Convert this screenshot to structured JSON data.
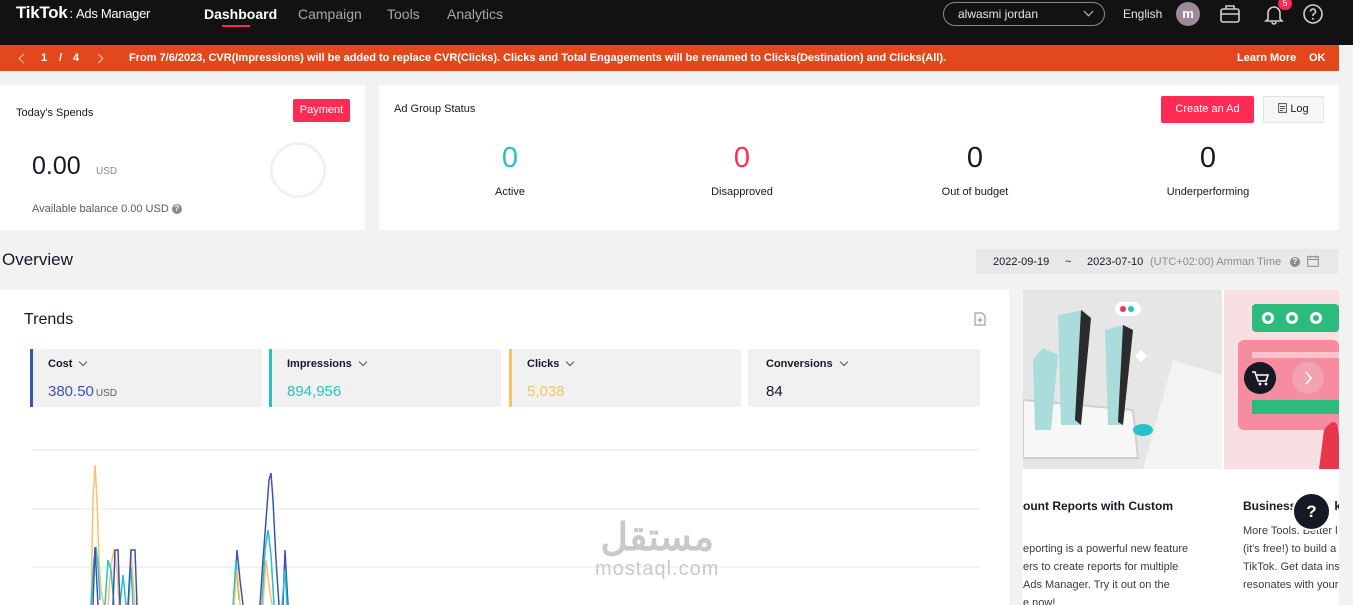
{
  "brand": {
    "logo": "TikTok",
    "product": "Ads Manager"
  },
  "nav": {
    "items": [
      {
        "label": "Dashboard",
        "active": true
      },
      {
        "label": "Campaign",
        "active": false
      },
      {
        "label": "Tools",
        "active": false
      },
      {
        "label": "Analytics",
        "active": false
      }
    ]
  },
  "header": {
    "account_name": "alwasmi jordan",
    "language": "English",
    "avatar_letter": "m",
    "notification_count": "5"
  },
  "banner": {
    "page_current": "1",
    "page_separator": "/",
    "page_total": "4",
    "message": "From 7/6/2023, CVR(Impressions) will be added to replace CVR(Clicks). Clicks and Total Engagements will be renamed to Clicks(Destination) and Clicks(All).",
    "learn_more": "Learn More",
    "ok": "OK",
    "color": "#e2481c"
  },
  "spends": {
    "title": "Today's Spends",
    "payment_label": "Payment",
    "amount": "0.00",
    "currency": "USD",
    "balance_text": "Available balance 0.00 USD"
  },
  "ad_group_status": {
    "title": "Ad Group Status",
    "create_label": "Create an Ad",
    "log_label": "Log",
    "stats": [
      {
        "value": "0",
        "label": "Active",
        "color": "#25c2c7"
      },
      {
        "value": "0",
        "label": "Disapproved",
        "color": "#fe2c55"
      },
      {
        "value": "0",
        "label": "Out of budget",
        "color": "#161823"
      },
      {
        "value": "0",
        "label": "Underperforming",
        "color": "#161823"
      }
    ]
  },
  "overview": {
    "title": "Overview",
    "date_start": "2022-09-19",
    "date_sep": "~",
    "date_end": "2023-07-10",
    "timezone": "(UTC+02:00) Amman Time"
  },
  "trends": {
    "title": "Trends",
    "metrics": [
      {
        "label": "Cost",
        "value": "380.50",
        "unit": "USD",
        "color": "#3f51b5"
      },
      {
        "label": "Impressions",
        "value": "894,956",
        "unit": "",
        "color": "#25c2c7"
      },
      {
        "label": "Clicks",
        "value": "5,038",
        "unit": "",
        "color": "#f7c26e"
      },
      {
        "label": "Conversions",
        "value": "84",
        "unit": "",
        "color": "#d8d8d8"
      }
    ]
  },
  "promo": {
    "card1_title": "ount Reports with Custom",
    "card1_lines": [
      "eporting is a powerful new feature",
      "ers to create reports for multiple",
      "Ads Manager. Try it out on the",
      "e now!"
    ],
    "card2_title": "Business",
    "card2_title_cut": "kT",
    "card2_lines": [
      "More Tools. Better l",
      "(it's free!) to build a",
      "TikTok. Get data ins",
      "resonates with your"
    ]
  },
  "watermark": {
    "arabic": "مستقل",
    "latin": "mostaql.com"
  },
  "colors": {
    "accent": "#fe2c55",
    "nav_bg": "#121212",
    "teal": "#25c2c7"
  }
}
